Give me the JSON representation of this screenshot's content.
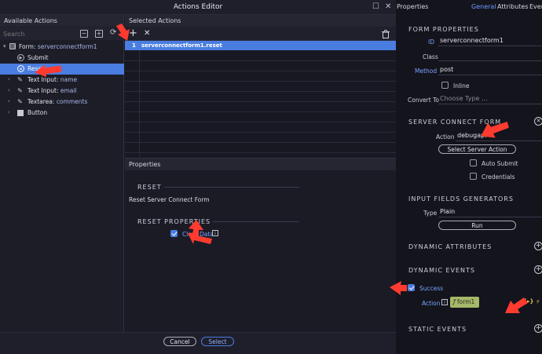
{
  "dialog": {
    "title": "Actions Editor",
    "available_header": "Available Actions",
    "search_placeholder": "Search",
    "tree": [
      {
        "label": "Form:",
        "value": "serverconnectform1"
      },
      {
        "label": "Submit",
        "value": ""
      },
      {
        "label": "Reset",
        "value": ""
      },
      {
        "label": "Text Input:",
        "value": "name"
      },
      {
        "label": "Text Input:",
        "value": "email"
      },
      {
        "label": "Textarea:",
        "value": "comments"
      },
      {
        "label": "Button",
        "value": ""
      }
    ],
    "selected_header": "Selected Actions",
    "selected_rows": [
      {
        "num": "1",
        "label": "serverconnectform1.reset"
      }
    ],
    "properties_header": "Properties",
    "reset_title": "RESET",
    "reset_desc": "Reset Server Connect Form",
    "reset_props_title": "RESET PROPERTIES",
    "clear_data_label": "Clear Data",
    "cancel_label": "Cancel",
    "select_label": "Select"
  },
  "panel": {
    "title": "Properties",
    "tabs": [
      "General",
      "Attributes",
      "Events"
    ],
    "form_properties_title": "FORM PROPERTIES",
    "id_label": "ID",
    "id_value": "serverconnectform1",
    "class_label": "Class",
    "method_label": "Method",
    "method_value": "post",
    "inline_label": "Inline",
    "convert_label": "Convert To",
    "convert_placeholder": "Choose Type ...",
    "server_connect_title": "SERVER CONNECT FORM",
    "action_label": "Action",
    "action_value": "debugapi",
    "select_server_action": "Select Server Action",
    "auto_submit_label": "Auto Submit",
    "credentials_label": "Credentials",
    "input_generators_title": "INPUT FIELDS GENERATORS",
    "type_label": "Type",
    "type_value": "Plain",
    "run_label": "Run",
    "dynamic_attributes_title": "DYNAMIC ATTRIBUTES",
    "dynamic_events_title": "DYNAMIC EVENTS",
    "success_label": "Success",
    "event_action_label": "Action",
    "event_action_value": "form1",
    "static_events_title": "STATIC EVENTS"
  },
  "colors": {
    "accent": "#4a7de0",
    "annotation_arrow": "#ff3b30",
    "action_chip": "#a6b86a"
  }
}
